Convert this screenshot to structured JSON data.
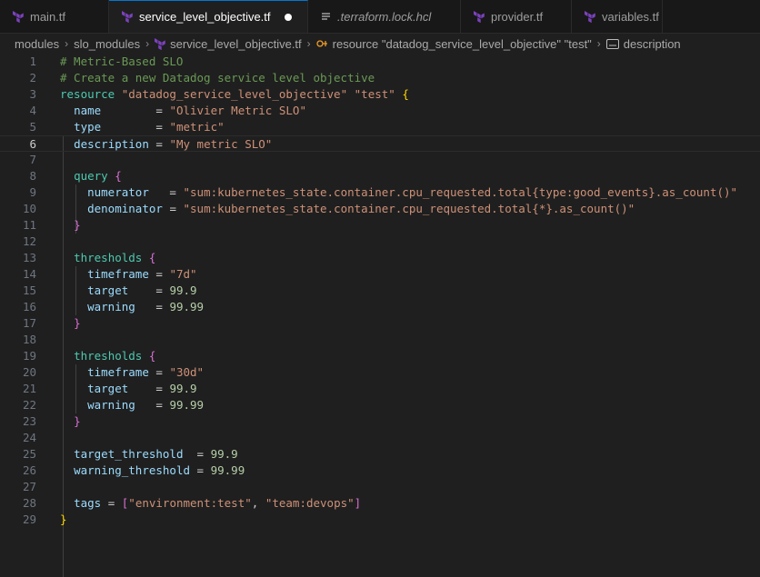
{
  "tabs": [
    {
      "label": "main.tf",
      "icon": "terraform-icon"
    },
    {
      "label": "service_level_objective.tf",
      "icon": "terraform-icon",
      "active": true,
      "modified": true
    },
    {
      "label": ".terraform.lock.hcl",
      "icon": "lines-icon"
    },
    {
      "label": "provider.tf",
      "icon": "terraform-icon"
    },
    {
      "label": "variables.tf",
      "icon": "terraform-icon"
    }
  ],
  "breadcrumb": [
    "modules",
    "slo_modules",
    "service_level_objective.tf",
    "resource \"datadog_service_level_objective\" \"test\"",
    "description"
  ],
  "lines": [
    {
      "n": "1",
      "t": "# Metric-Based SLO"
    },
    {
      "n": "2",
      "t": "# Create a new Datadog service level objective"
    },
    {
      "n": "3",
      "t": "resource \"datadog_service_level_objective\" \"test\" {"
    },
    {
      "n": "4",
      "t": "  name        = \"Olivier Metric SLO\""
    },
    {
      "n": "5",
      "t": "  type        = \"metric\""
    },
    {
      "n": "6",
      "t": "  description = \"My metric SLO\""
    },
    {
      "n": "7",
      "t": ""
    },
    {
      "n": "8",
      "t": "  query {"
    },
    {
      "n": "9",
      "t": "    numerator   = \"sum:kubernetes_state.container.cpu_requested.total{type:good_events}.as_count()\""
    },
    {
      "n": "10",
      "t": "    denominator = \"sum:kubernetes_state.container.cpu_requested.total{*}.as_count()\""
    },
    {
      "n": "11",
      "t": "  }"
    },
    {
      "n": "12",
      "t": ""
    },
    {
      "n": "13",
      "t": "  thresholds {"
    },
    {
      "n": "14",
      "t": "    timeframe = \"7d\""
    },
    {
      "n": "15",
      "t": "    target    = 99.9"
    },
    {
      "n": "16",
      "t": "    warning   = 99.99"
    },
    {
      "n": "17",
      "t": "  }"
    },
    {
      "n": "18",
      "t": ""
    },
    {
      "n": "19",
      "t": "  thresholds {"
    },
    {
      "n": "20",
      "t": "    timeframe = \"30d\""
    },
    {
      "n": "21",
      "t": "    target    = 99.9"
    },
    {
      "n": "22",
      "t": "    warning   = 99.99"
    },
    {
      "n": "23",
      "t": "  }"
    },
    {
      "n": "24",
      "t": ""
    },
    {
      "n": "25",
      "t": "  target_threshold  = 99.9"
    },
    {
      "n": "26",
      "t": "  warning_threshold = 99.99"
    },
    {
      "n": "27",
      "t": ""
    },
    {
      "n": "28",
      "t": "  tags = [\"environment:test\", \"team:devops\"]"
    },
    {
      "n": "29",
      "t": "}"
    }
  ],
  "current_line": "6",
  "colors": {
    "terraform": "#7b42bc",
    "accent": "#0078d4"
  }
}
